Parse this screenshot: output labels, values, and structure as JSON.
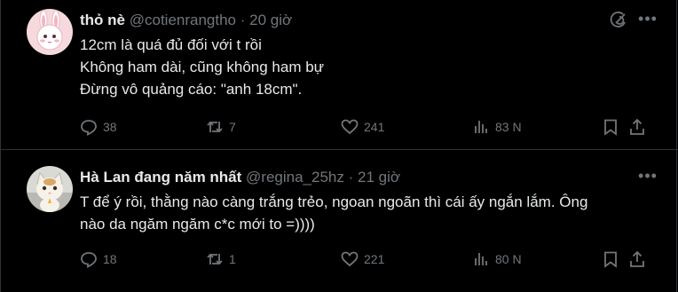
{
  "posts": [
    {
      "name": "thỏ nè",
      "handle": "@cotienrangtho",
      "separator": "·",
      "time": "20 giờ",
      "lines": [
        "12cm là quá đủ đối với t rồi",
        "Không ham dài, cũng không ham bự",
        "Đừng vô quảng cáo: \"anh 18cm\"."
      ],
      "replies": "38",
      "reposts": "7",
      "likes": "241",
      "views": "83 N"
    },
    {
      "name": "Hà Lan đang năm nhất",
      "handle": "@regina_25hz",
      "separator": "·",
      "time": "21 giờ",
      "lines": [
        "T để ý rồi, thằng nào càng trắng trẻo, ngoan ngoãn thì cái ấy ngắn lắm. Ông",
        "nào da ngăm ngăm c*c mới to =))))"
      ],
      "replies": "18",
      "reposts": "1",
      "likes": "221",
      "views": "80 N"
    }
  ],
  "icons": {
    "reply": "reply-icon",
    "repost": "repost-icon",
    "like": "heart-icon",
    "views": "views-icon",
    "bookmark": "bookmark-icon",
    "share": "share-icon",
    "grok": "grok-icon",
    "more": "more-icon"
  },
  "colors": {
    "background": "#000000",
    "text": "#e7e9ea",
    "muted": "#71767b",
    "border": "#2f3336"
  }
}
